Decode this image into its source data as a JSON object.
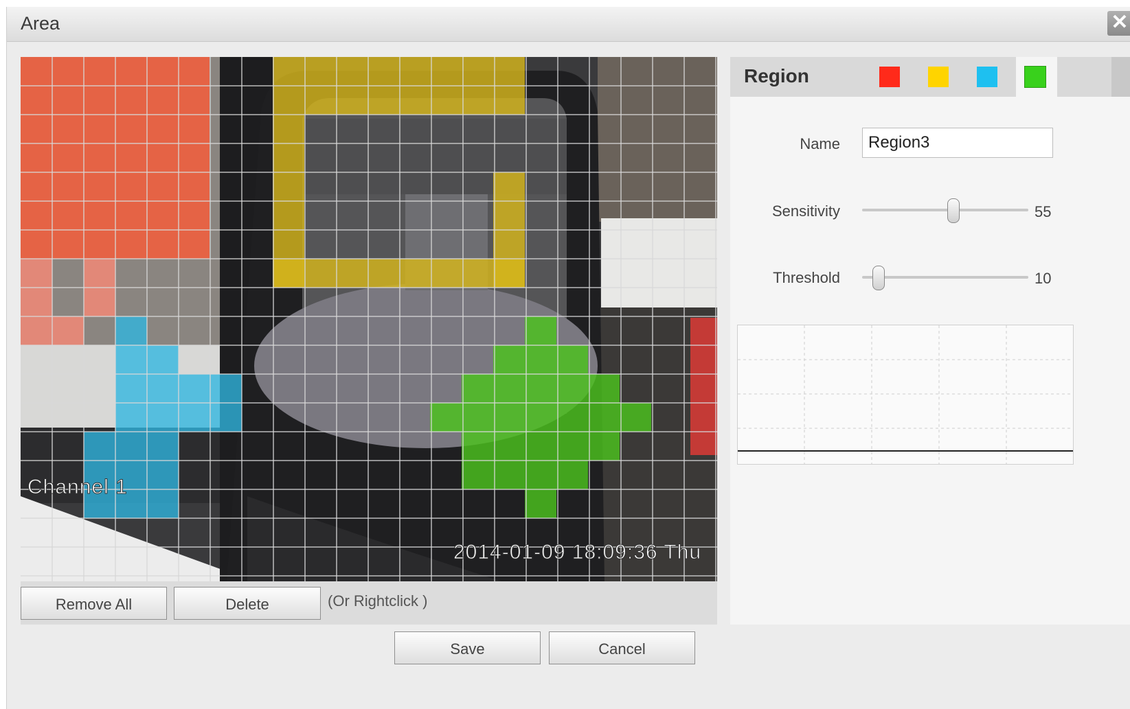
{
  "dialog": {
    "title": "Area"
  },
  "video": {
    "channel_label": "Channel 1",
    "timestamp": "2014-01-09 18:09:36 Thu"
  },
  "toolbar": {
    "remove_all_label": "Remove All",
    "delete_label": "Delete",
    "hint": "(Or Rightclick )"
  },
  "region_panel": {
    "title": "Region",
    "swatch_colors": [
      "#ff2a1a",
      "#ffd400",
      "#1ec0f0",
      "#39d11c"
    ],
    "selected_swatch": "green",
    "name_label": "Name",
    "name_value": "Region3",
    "sensitivity_label": "Sensitivity",
    "sensitivity_value": "55",
    "sensitivity_fraction": 0.55,
    "threshold_label": "Threshold",
    "threshold_value": "10",
    "threshold_fraction": 0.1
  },
  "footer": {
    "save_label": "Save",
    "cancel_label": "Cancel"
  },
  "colors": {
    "region_red": "#ff5a35",
    "region_yellow": "#d6b61c",
    "region_blue": "#2fb6e0",
    "region_green": "#4cc21d"
  }
}
